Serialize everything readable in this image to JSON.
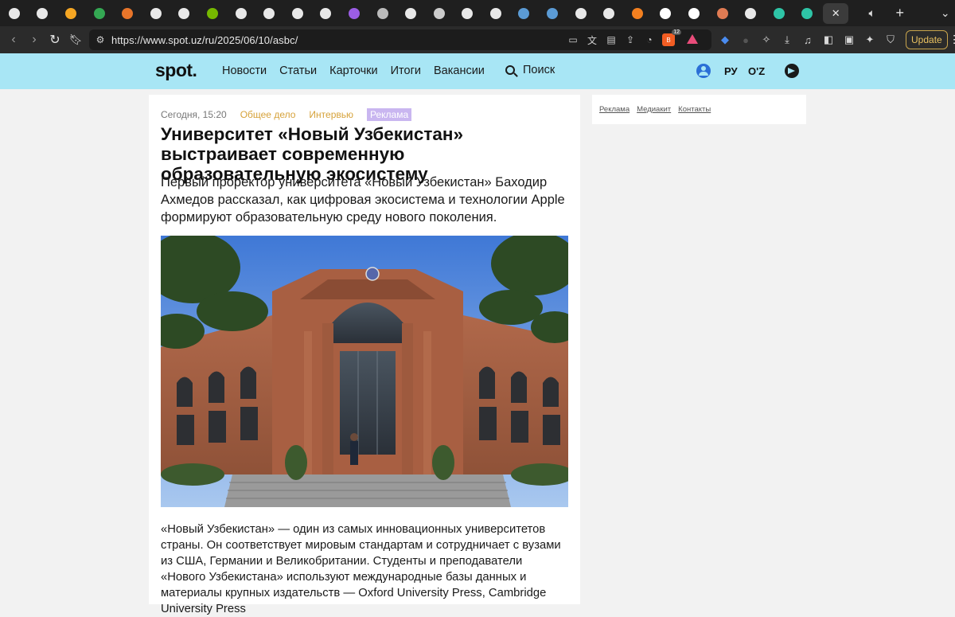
{
  "browser": {
    "tabs": [
      {
        "icon": "github-icon",
        "color": "#e8e8e8"
      },
      {
        "icon": "openai-icon",
        "color": "#e8e8e8"
      },
      {
        "icon": "infinity-icon",
        "color": "#f5a623"
      },
      {
        "icon": "google-drive-icon",
        "color": "#34a853"
      },
      {
        "icon": "sparkle-icon",
        "color": "#e8752a"
      },
      {
        "icon": "openai-icon",
        "color": "#e8e8e8"
      },
      {
        "icon": "openai-icon",
        "color": "#e8e8e8"
      },
      {
        "icon": "nvidia-icon",
        "color": "#76b900"
      },
      {
        "icon": "github-icon",
        "color": "#e8e8e8"
      },
      {
        "icon": "github-icon",
        "color": "#e8e8e8"
      },
      {
        "icon": "github-icon",
        "color": "#e8e8e8"
      },
      {
        "icon": "github-icon",
        "color": "#e8e8e8"
      },
      {
        "icon": "phoenix-icon",
        "color": "#9b5de5"
      },
      {
        "icon": "globe-icon",
        "color": "#bbbbbb"
      },
      {
        "icon": "github-icon",
        "color": "#e8e8e8"
      },
      {
        "icon": "search-circle-icon",
        "color": "#cccccc"
      },
      {
        "icon": "github-icon",
        "color": "#e8e8e8"
      },
      {
        "icon": "github-icon",
        "color": "#e8e8e8"
      },
      {
        "icon": "k-icon",
        "color": "#5b9bd5"
      },
      {
        "icon": "k-icon",
        "color": "#5b9bd5"
      },
      {
        "icon": "github-icon",
        "color": "#e8e8e8"
      },
      {
        "icon": "github-icon",
        "color": "#e8e8e8"
      },
      {
        "icon": "cloudflare-icon",
        "color": "#f38020"
      },
      {
        "icon": "exclamation-icon",
        "color": "#ffffff"
      },
      {
        "icon": "a-icon",
        "color": "#ffffff"
      },
      {
        "icon": "robot-icon",
        "color": "#e07b53"
      },
      {
        "icon": "github-icon",
        "color": "#e8e8e8"
      },
      {
        "icon": "chat-icon",
        "color": "#2ec4a6"
      },
      {
        "icon": "chat-icon",
        "color": "#2ec4a6"
      }
    ],
    "url": "https://www.spot.uz/ru/2025/06/10/asbc/",
    "brave_count": "12",
    "update_label": "Update"
  },
  "site": {
    "logo": "spot.",
    "nav": [
      "Новости",
      "Статьи",
      "Карточки",
      "Итоги",
      "Вакансии"
    ],
    "search_label": "Поиск",
    "lang_ru": "РУ",
    "lang_uz": "O'Z",
    "accent": "#a8e6f5"
  },
  "article": {
    "date": "Сегодня, 15:20",
    "category1": "Общее дело",
    "category2": "Интервью",
    "ad_label": "Реклама",
    "title": "Университет «Новый Узбекистан» выстраивает современную образовательную экосистему",
    "lead": "Первый проректор университета «Новый Узбекистан» Баходир Ахмедов рассказал, как цифровая экосистема и технологии Apple формируют образовательную среду нового поколения.",
    "body": "«Новый Узбекистан» — один из самых инновационных университетов страны. Он соответствует мировым стандартам и сотрудничает с вузами из США, Германии и Великобритании. Студенты и преподаватели «Нового Узбекистана» используют международные базы данных и материалы крупных издательств — Oxford University Press, Cambridge University Press"
  },
  "sidebar": {
    "links": [
      "Реклама",
      "Медиакит",
      "Контакты"
    ]
  }
}
